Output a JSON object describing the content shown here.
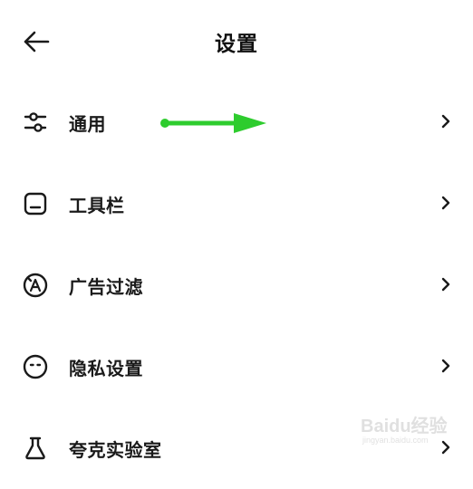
{
  "header": {
    "title": "设置",
    "back_icon": "arrow-left-icon"
  },
  "menu": {
    "items": [
      {
        "label": "通用",
        "icon": "sliders-icon"
      },
      {
        "label": "工具栏",
        "icon": "toolbar-icon"
      },
      {
        "label": "广告过滤",
        "icon": "ad-block-icon"
      },
      {
        "label": "隐私设置",
        "icon": "privacy-face-icon"
      },
      {
        "label": "夸克实验室",
        "icon": "flask-icon"
      }
    ],
    "chevron_icon": "chevron-right-icon"
  },
  "annotation": {
    "icon": "green-arrow-annotation",
    "color": "#2ecc2e"
  },
  "watermark": {
    "text": "Baidu经验",
    "sub": "jingyan.baidu.com"
  },
  "colors": {
    "text": "#1a1a1a",
    "background": "#ffffff",
    "annotation_arrow": "#2ecc2e"
  }
}
